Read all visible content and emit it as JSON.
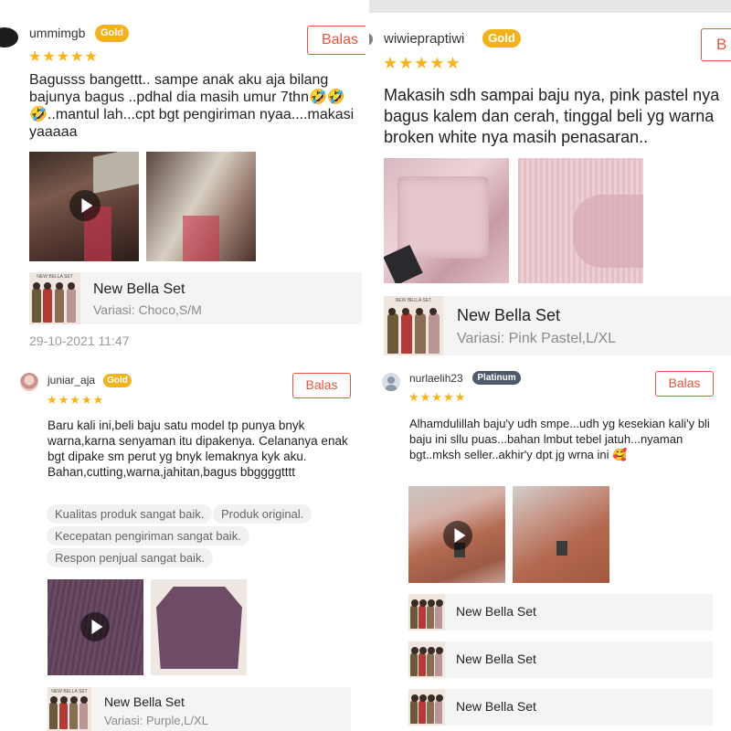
{
  "reviews": [
    {
      "username": "ummimgb",
      "badge": "Gold",
      "reply_label": "Balas",
      "rating": "★★★★★",
      "text": "Bagusss bangettt.. sampe anak aku aja bilang bajunya bagus ..pdhal dia masih umur 7thn🤣🤣🤣..mantul lah...cpt bgt pengiriman nyaa....makasi yaaaaa",
      "product_name": "New Bella Set",
      "variation": "Variasi: Choco,S/M",
      "date": "29-10-2021 11:47"
    },
    {
      "username": "juniar_aja",
      "badge": "Gold",
      "reply_label": "Balas",
      "rating": "★★★★★",
      "text": "Baru kali ini,beli baju satu model tp punya bnyk warna,karna senyaman itu dipakenya. Celananya enak bgt dipake sm perut yg bnyk lemaknya kyk aku.   Bahan,cutting,warna,jahitan,bagus bbggggtttt",
      "tags": [
        "Kualitas produk sangat baik.",
        "Produk original.",
        "Kecepatan pengiriman sangat baik.",
        "Respon penjual sangat baik."
      ],
      "product_name": "New Bella Set",
      "variation": "Variasi: Purple,L/XL"
    },
    {
      "username": "wiwiepraptiwi",
      "badge": "Gold",
      "reply_label": "B",
      "rating": "★★★★★",
      "text": "Makasih sdh sampai baju nya, pink pastel nya bagus kalem dan cerah, tinggal beli yg warna broken white nya masih penasaran..",
      "product_name": "New Bella Set",
      "variation": "Variasi: Pink Pastel,L/XL"
    },
    {
      "username": "nurlaelih23",
      "badge": "Platinum",
      "reply_label": "Balas",
      "rating": "★★★★★",
      "text": "Alhamdulillah baju'y udh smpe...udh yg kesekian kali'y bli baju ini sllu puas...bahan lmbut tebel jatuh...nyaman bgt..mksh seller..akhir'y dpt jg wrna ini 🥰",
      "products": [
        "New Bella Set",
        "New Bella Set",
        "New Bella Set"
      ]
    }
  ],
  "product_image_label": "NEW BELLA SET",
  "colors": {
    "accent": "#e7553d",
    "gold_badge": "#f3b21b",
    "platinum_badge": "#4e5a6c",
    "star": "#f7b41a"
  },
  "icons": [
    "play-icon",
    "star-icon",
    "avatar"
  ]
}
